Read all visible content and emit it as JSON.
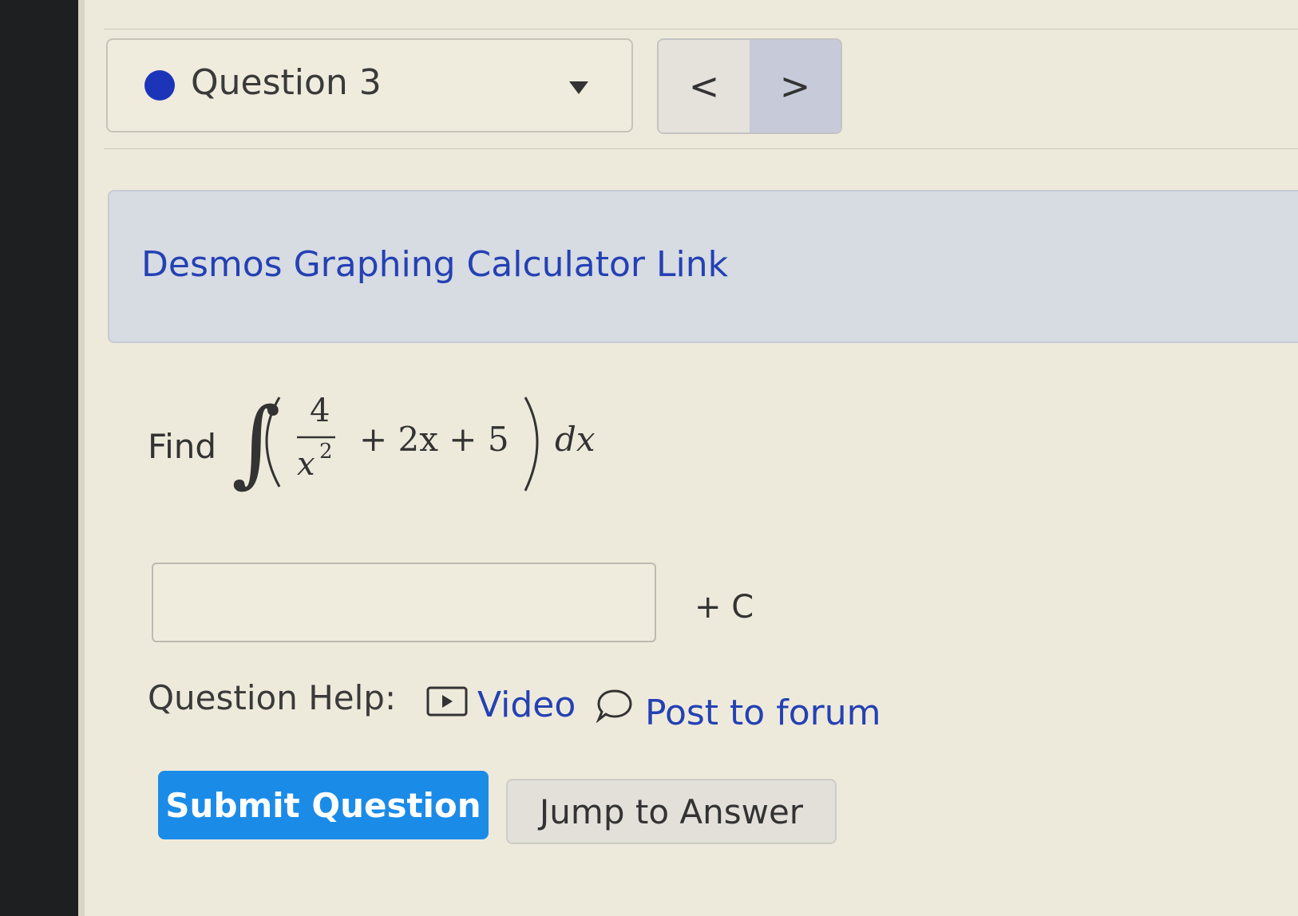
{
  "question_nav": {
    "selected": "Question 3",
    "prev_symbol": "<",
    "next_symbol": ">"
  },
  "desmos": {
    "link_text": "Desmos Graphing Calculator Link"
  },
  "problem": {
    "prompt": "Find",
    "integrand": {
      "numerator": "4",
      "denominator": "x",
      "denominator_exponent": "2",
      "rest": "+ 2x + 5",
      "differential": "dx"
    }
  },
  "answer": {
    "value": "",
    "suffix": "+ C"
  },
  "help": {
    "label": "Question Help:",
    "video": "Video",
    "forum": "Post to forum"
  },
  "actions": {
    "submit": "Submit Question",
    "jump": "Jump to Answer"
  },
  "colors": {
    "link": "#2441b4",
    "submit_bg": "#1b8be8",
    "question_dot": "#1c35b8"
  }
}
